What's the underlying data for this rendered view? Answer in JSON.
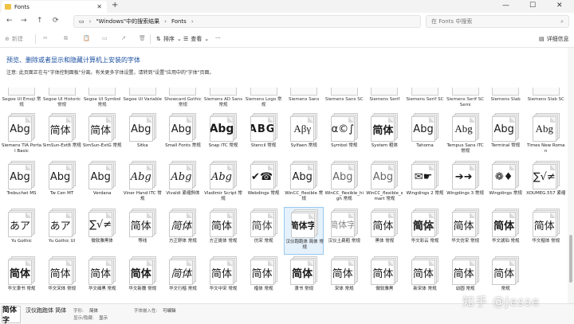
{
  "window": {
    "tab_title": "Fonts",
    "new_tab": "+",
    "minimize": "—",
    "maximize": "☐",
    "close": "✕"
  },
  "nav": {
    "back": "←",
    "forward": "→",
    "up": "↑",
    "refresh": "⟳",
    "breadcrumb": [
      "\"Windows\"中的搜索结果",
      "Fonts"
    ],
    "search_placeholder": "在 Fonts 中搜索"
  },
  "commands": {
    "new": "新建",
    "sort": "排序",
    "view": "查看",
    "more": "···",
    "details": "详细信息"
  },
  "content": {
    "heading": "预览、删除或者显示和隐藏计算机上安装的字体",
    "note": "注意: 此页面正在与\"字体控制面板\"分离。有关更多字体设置，请转到\"设置\"应用中的\"字体\"页面。"
  },
  "partial_row": [
    "Segoe UI Emoji 常规",
    "Segoe UI Historic 常规",
    "Segoe UI Symbol 常规",
    "Segoe UI Variable",
    "Showcard Gothic 常规",
    "Siemens AD Sans 常规",
    "Siemens Logo 常规",
    "Siemens Sans",
    "Siemens Sans SC",
    "Siemens Serif",
    "Siemens Serif SC",
    "Siemens Serif SC Semi",
    "Siemens Slab",
    "Siemens Slab SC"
  ],
  "fonts": [
    [
      {
        "sample": "Abg",
        "label": "Siemens TIA Portal Basic"
      },
      {
        "sample": "简体",
        "label": "SimSun-ExtB 常规"
      },
      {
        "sample": "简体",
        "label": "SimSun-ExtG 常规"
      },
      {
        "sample": "Abg",
        "label": "Sitka"
      },
      {
        "sample": "Abg",
        "label": "Small Fonts 常规"
      },
      {
        "sample": "Abg",
        "label": "Snap ITC 常规"
      },
      {
        "sample": "ABG",
        "label": "Stencil 常规"
      },
      {
        "sample": "Αβγ",
        "label": "Sylfaen 常规"
      },
      {
        "sample": "α©∫",
        "label": "Symbol 常规"
      },
      {
        "sample": "简体",
        "label": "System 粗体"
      },
      {
        "sample": "Abg",
        "label": "Tahoma"
      },
      {
        "sample": "Abg",
        "label": "Tempus Sans ITC 常规"
      },
      {
        "sample": "Abg",
        "label": "Terminal 常规"
      },
      {
        "sample": "Abg",
        "label": "Times New Roman"
      }
    ],
    [
      {
        "sample": "Abg",
        "label": "Trebuchet MS"
      },
      {
        "sample": "Abg",
        "label": "Tw Cen MT"
      },
      {
        "sample": "Abg",
        "label": "Verdana"
      },
      {
        "sample": "Abg",
        "label": "Viner Hand ITC 常规"
      },
      {
        "sample": "Abg",
        "label": "Vivaldi 紧缩斜体"
      },
      {
        "sample": "Abg",
        "label": "Vladimir Script 常规"
      },
      {
        "sample": "✔☎",
        "label": "Webdings 常规"
      },
      {
        "sample": "Abg",
        "label": "WinCC_flexible 常规"
      },
      {
        "sample": "Abg",
        "label": "WinCC_flexible_high 常规"
      },
      {
        "sample": "Abg",
        "label": "WinCC_flexible_smart 常规"
      },
      {
        "sample": "✉☛",
        "label": "Wingdings 2 常规"
      },
      {
        "sample": "➔➜",
        "label": "Wingdings 3 常规"
      },
      {
        "sample": "❁♦",
        "label": "Wingdings 常规"
      },
      {
        "sample": "∑√≠",
        "label": "XOUMEG.557 紧缩"
      }
    ],
    [
      {
        "sample": "あア",
        "label": "Yu Gothic"
      },
      {
        "sample": "あア",
        "label": "Yu Gothic UI"
      },
      {
        "sample": "∑√≠",
        "label": "微软雅黑体"
      },
      {
        "sample": "简体",
        "label": "等线"
      },
      {
        "sample": "简体",
        "label": "方正舒体 常规"
      },
      {
        "sample": "简体",
        "label": "方正姚体 常规"
      },
      {
        "sample": "简体",
        "label": "仿宋 常规"
      },
      {
        "sample": "简体字",
        "label": "汉仪跑跑体 简体 常规",
        "selected": true
      },
      {
        "sample": "简体字",
        "label": "汉仪土扁粗 常规"
      },
      {
        "sample": "简体",
        "label": "黑体 常规"
      },
      {
        "sample": "简体",
        "label": "华文彩云 常规"
      },
      {
        "sample": "简体",
        "label": "华文仿宋 常规"
      },
      {
        "sample": "简体",
        "label": "华文琥珀 常规"
      },
      {
        "sample": "简体",
        "label": "华文楷体 常规"
      }
    ],
    [
      {
        "sample": "简体",
        "label": "华文隶书 常规"
      },
      {
        "sample": "简体",
        "label": "华文宋体 常规"
      },
      {
        "sample": "简体",
        "label": "华文细黑 常规"
      },
      {
        "sample": "简体",
        "label": "华文新魏 常规"
      },
      {
        "sample": "简体",
        "label": "华文行楷 常规"
      },
      {
        "sample": "简体",
        "label": "华文中宋 常规"
      },
      {
        "sample": "简体",
        "label": "楷体 常规"
      },
      {
        "sample": "简体",
        "label": "隶书 常规"
      },
      {
        "sample": "简体",
        "label": "宋体 常规"
      },
      {
        "sample": "简体",
        "label": "微软雅黑"
      },
      {
        "sample": "简体",
        "label": "新宋体 常规"
      },
      {
        "sample": "简体",
        "label": "幼圆 常规"
      },
      {
        "sample": "简体",
        "label": "常规"
      }
    ]
  ],
  "details": {
    "preview": "简体字",
    "name": "汉仪跑跑体 简体",
    "style_key": "字形:",
    "style_val": "简体",
    "show_key": "显示/隐藏:",
    "show_val": "显示",
    "embed_key": "字体嵌入性:",
    "embed_val": "可编辑"
  },
  "watermark": "知乎 @Jesse"
}
